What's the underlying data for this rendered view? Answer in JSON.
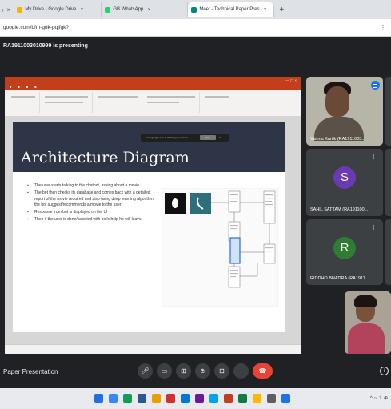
{
  "browser": {
    "tabs": [
      {
        "label": "My Drive - Google Drive",
        "color": "#f4b400"
      },
      {
        "label": "GB WhatsApp",
        "color": "#25d366"
      },
      {
        "label": "Meet - Technical Paper Pres",
        "color": "#00897b"
      }
    ],
    "url": "google.com/bfm-gdk-pqjfgk?"
  },
  "meet": {
    "presenting_label": "RA1911003010999 is presenting",
    "meeting_title": "Paper Presentation",
    "participants": [
      {
        "name": "Vishnu Kartik (RA1911003...",
        "initial": "",
        "avatar_color": ""
      },
      {
        "name": "SAHIL SATTAM (RA191100...",
        "initial": "S",
        "avatar_color": "#6a3ab2"
      },
      {
        "name": "RIDDHO BHADRA (RA1911...",
        "initial": "R",
        "avatar_color": "#2e7d32"
      }
    ],
    "controls": [
      "microphone",
      "captions",
      "present",
      "raise-hand",
      "more-options",
      "leave-call"
    ]
  },
  "slide": {
    "title": "Architecture Diagram",
    "share_notice": "meet.google.com is sharing your screen.",
    "share_button": "Hide",
    "bullets": [
      "The user starts talking to the chatbot, asking about a movie",
      "The bot then checks its database and comes back with a detailed report of the movie required and also using deep learning algorithm the bot suggest/recommends a movie to the user",
      "Response from bot is displayed on the UI",
      "Then if the user is done/satisfied with bot's help he will leave"
    ]
  },
  "taskbar": {
    "icons": [
      "#1f6fe5",
      "#3a86ff",
      "#0f9d58",
      "#2b579a",
      "#e6a100",
      "#d32f2f",
      "#0078d4",
      "#6a1b9a",
      "#00a4ef",
      "#c43e1c",
      "#107c41",
      "#ffb900",
      "#5e5e5e",
      "#1a73e8"
    ],
    "tray_text": "^ ∩ ⇧ ⊕"
  }
}
